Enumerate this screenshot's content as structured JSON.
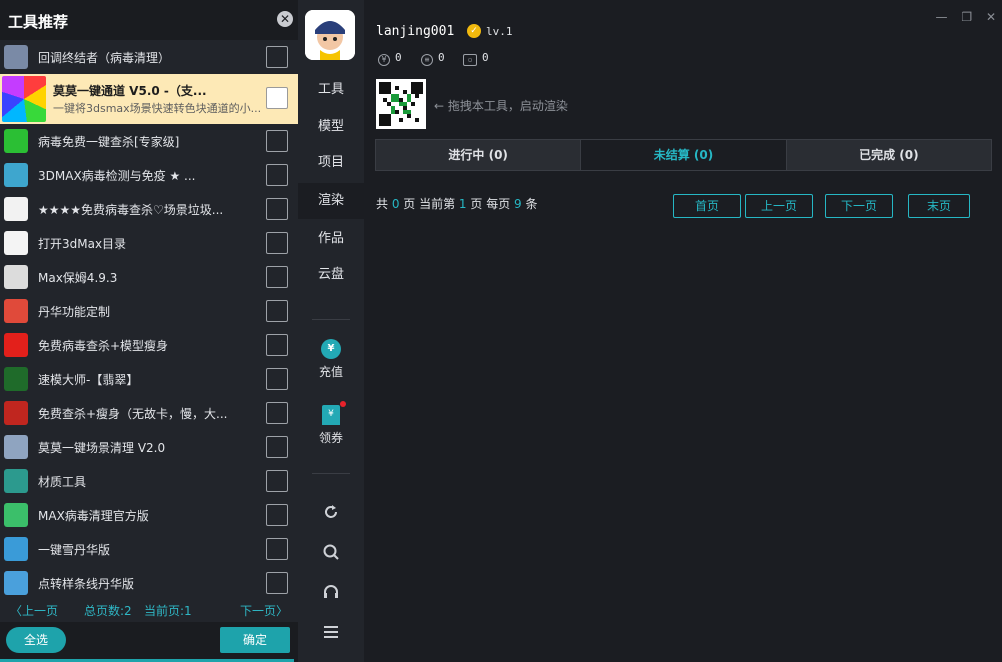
{
  "left_panel": {
    "title": "工具推荐",
    "close_icon": "close-icon",
    "tools": [
      {
        "name": "回调终结者（病毒清理）",
        "icon_color": "#7a8aa6"
      },
      {
        "name": "莫莫一键通道 V5.0 -（支...",
        "desc": "一键将3dsmax场景快速转色块通道的小...",
        "icon_color": "#ff3d3d",
        "highlight": true
      },
      {
        "name": "病毒免费一键查杀[专家级]",
        "icon_color": "#2bbf34"
      },
      {
        "name": "3DMAX病毒检测与免疫 ★ ...",
        "icon_color": "#3ea6ce"
      },
      {
        "name": "★★★★免费病毒查杀♡场景垃圾...",
        "icon_color": "#f2f2f2"
      },
      {
        "name": "打开3dMax目录",
        "icon_color": "#f4f4f4"
      },
      {
        "name": "Max保姆4.9.3",
        "icon_color": "#dcdcdc"
      },
      {
        "name": "丹华功能定制",
        "icon_color": "#e04a3a"
      },
      {
        "name": "免费病毒查杀+模型瘦身",
        "icon_color": "#e3201b"
      },
      {
        "name": "速模大师-【翡翠】",
        "icon_color": "#1f6b2a"
      },
      {
        "name": "免费查杀+瘦身（无故卡，慢，大...",
        "icon_color": "#c0261f"
      },
      {
        "name": "莫莫一键场景清理 V2.0",
        "icon_color": "#8fa4c0"
      },
      {
        "name": "材质工具",
        "icon_color": "#2c9a8e"
      },
      {
        "name": "MAX病毒清理官方版",
        "icon_color": "#3bbf6a"
      },
      {
        "name": "一键雪丹华版",
        "icon_color": "#3a9bd8"
      },
      {
        "name": "点转样条线丹华版",
        "icon_color": "#4aa0dc"
      }
    ],
    "pager": {
      "prev": "〈上一页",
      "total": "总页数:2",
      "current": "当前页:1",
      "next": "下一页〉"
    },
    "select_all": "全选",
    "confirm": "确定"
  },
  "nav": {
    "items": [
      {
        "label": "工具"
      },
      {
        "label": "模型"
      },
      {
        "label": "项目"
      },
      {
        "label": "渲染",
        "active": true
      },
      {
        "label": "作品"
      },
      {
        "label": "云盘"
      }
    ],
    "recharge": {
      "label": "充值",
      "icon": "yen-icon",
      "glyph": "¥"
    },
    "coupon": {
      "label": "领券",
      "icon": "coupon-icon",
      "glyph": "¥"
    },
    "system_icons": [
      "refresh-icon",
      "search-icon",
      "headset-icon",
      "menu-icon"
    ]
  },
  "header": {
    "username": "lanjing001",
    "level": "lv.1",
    "stats": {
      "yen": "0",
      "coins": "0",
      "tickets": "0"
    }
  },
  "main": {
    "hint": "← 拖拽本工具，启动渲染",
    "tabs": [
      {
        "label": "进行中 (0)"
      },
      {
        "label": "未结算 (0)",
        "active": true
      },
      {
        "label": "已完成 (0)"
      }
    ],
    "pager": {
      "t1": "共 ",
      "total_pages": "0",
      "t2": " 页 当前第 ",
      "current": "1",
      "t3": " 页 每页 ",
      "per_page": "9",
      "t4": " 条",
      "first": "首页",
      "prev": "上一页",
      "next": "下一页",
      "last": "末页"
    }
  },
  "colors": {
    "accent": "#1ea3ab",
    "highlight": "#fde9b6",
    "badge": "#f1b90e",
    "alert": "#e8222b"
  }
}
